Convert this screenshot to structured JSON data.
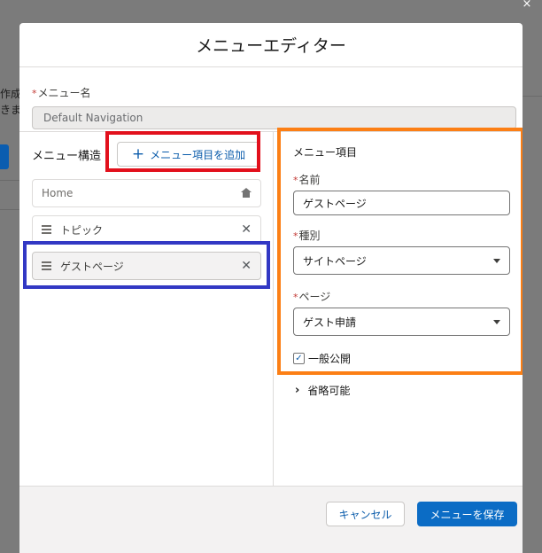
{
  "background": {
    "text_line_1": "作成し",
    "text_line_2": "きます"
  },
  "window": {
    "close_glyph": "×"
  },
  "modal": {
    "title": "メニューエディター",
    "menu_name": {
      "required_mark": "*",
      "label": "メニュー名",
      "value": "Default Navigation"
    },
    "menu_structure": {
      "label": "メニュー構造",
      "add_button_icon": "plus-icon",
      "add_button_label": "メニュー項目を追加",
      "items": [
        {
          "label": "Home",
          "icon": "home-icon"
        },
        {
          "label": "トピック",
          "icon": "drag-handle-icon"
        },
        {
          "label": "ゲストページ",
          "icon": "drag-handle-icon",
          "selected": true
        }
      ]
    },
    "menu_item": {
      "section_title": "メニュー項目",
      "name_label": "名前",
      "name_value": "ゲストページ",
      "type_label": "種別",
      "type_value": "サイトページ",
      "page_label": "ページ",
      "page_value": "ゲスト申請",
      "public_checkbox_label": "一般公開",
      "public_checked": true,
      "collapsible_label": "省略可能"
    },
    "footer": {
      "cancel_label": "キャンセル",
      "save_label": "メニューを保存"
    }
  },
  "colors": {
    "brand_blue": "#0b6cc5",
    "link_blue": "#0b5cab",
    "annotation_red": "#e2101c",
    "annotation_blue": "#3238c4",
    "annotation_orange": "#fc7f15"
  }
}
